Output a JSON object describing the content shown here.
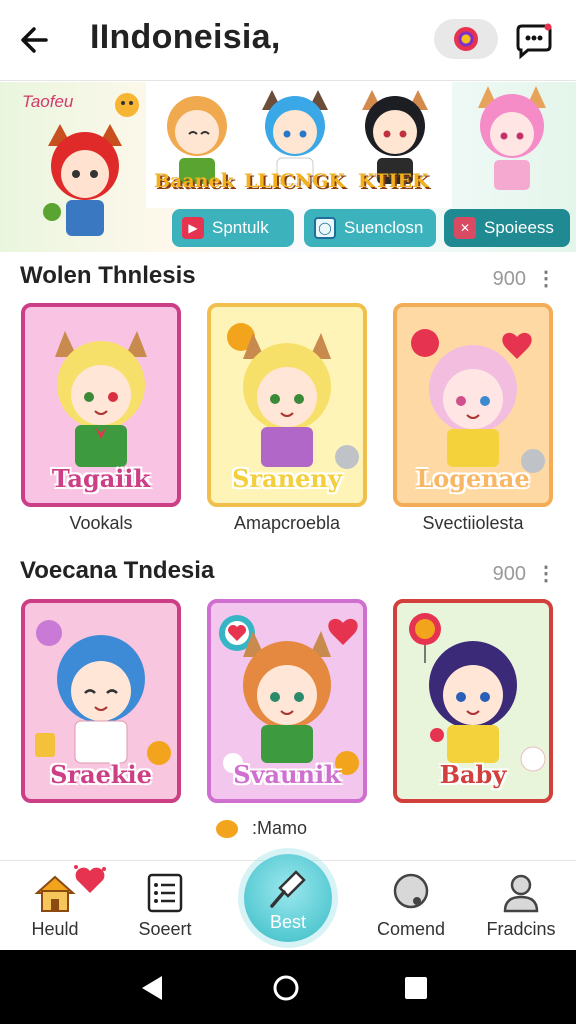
{
  "header": {
    "title": "IIndoneisia,",
    "back_icon": "arrow-left-icon",
    "record_icon": "record-icon",
    "chat_icon": "chat-icon"
  },
  "banner": {
    "tag": "Taofeu",
    "items": [
      "Baanek",
      "LLICNGK",
      "KTIEK"
    ],
    "buttons": [
      {
        "label": "Spntulk",
        "icon": "play-icon",
        "color": "#3cb2bd"
      },
      {
        "label": "Suenclosn",
        "icon": "circle-icon",
        "color": "#3cb2bd"
      },
      {
        "label": "Spoieess",
        "icon": "x-icon",
        "color": "#1f8a92"
      }
    ]
  },
  "sections": [
    {
      "title": "Wolen Thnlesis",
      "count": "900",
      "menu": "⋮",
      "cards": [
        {
          "name": "Tagaiik",
          "caption": "Vookals",
          "border": "#cc3e86",
          "bg": "#f9c3e4",
          "label_color": "#cc3e86",
          "hair": "#f7e06a",
          "shirt": "#3d9a3e"
        },
        {
          "name": "Sraneny",
          "caption": "Amapcroebla",
          "border": "#f1c04c",
          "bg": "#fff4b8",
          "label_color": "#f2cf3b",
          "hair": "#f7e06a",
          "shirt": "#b067c8"
        },
        {
          "name": "Logenae",
          "caption": "Svectiiolesta",
          "border": "#f3ad57",
          "bg": "#ffd9a3",
          "label_color": "#f7b765",
          "hair": "#f3bde0",
          "shirt": "#f4d23c"
        }
      ]
    },
    {
      "title": "Voecana Tndesia",
      "count": "900",
      "menu": "⋮",
      "cards": [
        {
          "name": "Sraekie",
          "caption": "",
          "border": "#cc3e86",
          "bg": "#f9c6e0",
          "label_color": "#cc3e86",
          "hair": "#3d8ad6",
          "shirt": "#ffffff"
        },
        {
          "name": "Svaunik",
          "caption": "",
          "border": "#cf6fd0",
          "bg": "#f3c6ee",
          "label_color": "#cf6fd0",
          "hair": "#e58940",
          "shirt": "#3d9a3e"
        },
        {
          "name": "Baby",
          "caption": "",
          "border": "#d2403d",
          "bg": "#e9f5db",
          "label_color": "#d2403d",
          "hair": "#3a2a78",
          "shirt": "#f4d23c"
        }
      ]
    }
  ],
  "mini_row": {
    "label": ":Mamo"
  },
  "bottom_nav": [
    {
      "label": "Heuld",
      "icon": "home-icon"
    },
    {
      "label": "Soeert",
      "icon": "list-icon"
    },
    {
      "label": "Best",
      "icon": "spatula-icon"
    },
    {
      "label": "Comend",
      "icon": "search-icon"
    },
    {
      "label": "Fradcins",
      "icon": "person-icon"
    }
  ]
}
